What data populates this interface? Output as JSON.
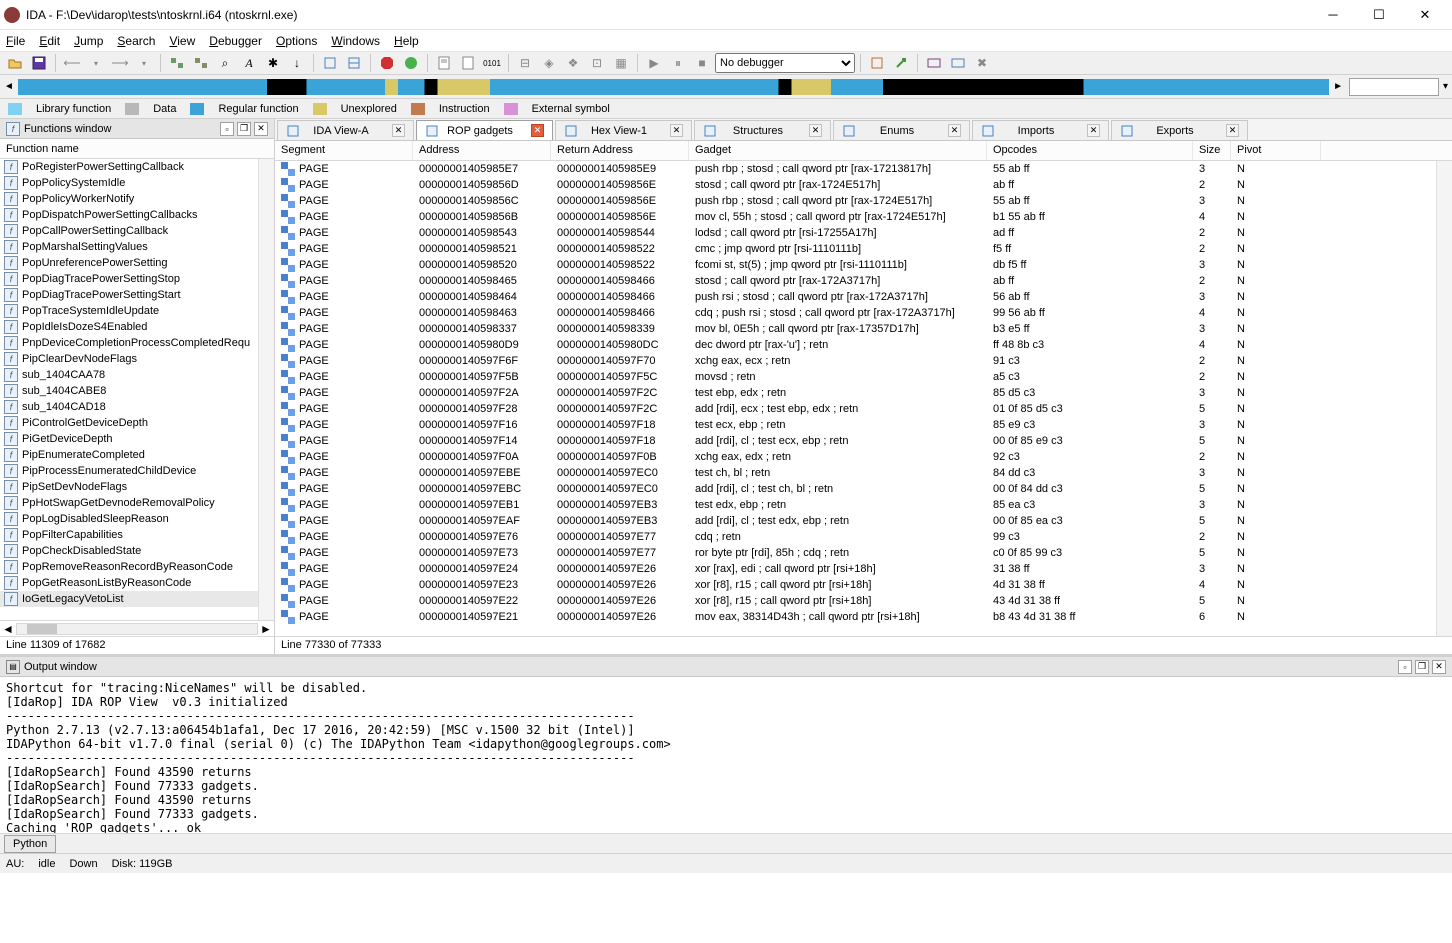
{
  "window": {
    "title": "IDA - F:\\Dev\\idarop\\tests\\ntoskrnl.i64 (ntoskrnl.exe)"
  },
  "menus": [
    "File",
    "Edit",
    "Jump",
    "Search",
    "View",
    "Debugger",
    "Options",
    "Windows",
    "Help"
  ],
  "debugger_select": "No debugger",
  "legend": [
    {
      "c": "#7fd3f0",
      "t": "Library function"
    },
    {
      "c": "#b8b8b8",
      "t": "Data"
    },
    {
      "c": "#3aa4d9",
      "t": "Regular function"
    },
    {
      "c": "#d8c867",
      "t": "Unexplored"
    },
    {
      "c": "#c47a4f",
      "t": "Instruction"
    },
    {
      "c": "#d892d8",
      "t": "External symbol"
    }
  ],
  "functions_title": "Functions window",
  "functions_col": "Function name",
  "functions": [
    "PoRegisterPowerSettingCallback",
    "PopPolicySystemIdle",
    "PopPolicyWorkerNotify",
    "PopDispatchPowerSettingCallbacks",
    "PopCallPowerSettingCallback",
    "PopMarshalSettingValues",
    "PopUnreferencePowerSetting",
    "PopDiagTracePowerSettingStop",
    "PopDiagTracePowerSettingStart",
    "PopTraceSystemIdleUpdate",
    "PopIdleIsDozeS4Enabled",
    "PnpDeviceCompletionProcessCompletedRequ",
    "PipClearDevNodeFlags",
    "sub_1404CAA78",
    "sub_1404CABE8",
    "sub_1404CAD18",
    "PiControlGetDeviceDepth",
    "PiGetDeviceDepth",
    "PipEnumerateCompleted",
    "PipProcessEnumeratedChildDevice",
    "PipSetDevNodeFlags",
    "PpHotSwapGetDevnodeRemovalPolicy",
    "PopLogDisabledSleepReason",
    "PopFilterCapabilities",
    "PopCheckDisabledState",
    "PopRemoveReasonRecordByReasonCode",
    "PopGetReasonListByReasonCode",
    "IoGetLegacyVetoList"
  ],
  "functions_sel": 27,
  "functions_status": "Line 11309 of 17682",
  "tabs": [
    {
      "l": "IDA View-A",
      "a": false,
      "icon": "ida"
    },
    {
      "l": "ROP gadgets",
      "a": true,
      "icon": "rop"
    },
    {
      "l": "Hex View-1",
      "a": false,
      "icon": "hex"
    },
    {
      "l": "Structures",
      "a": false,
      "icon": "struct"
    },
    {
      "l": "Enums",
      "a": false,
      "icon": "enum"
    },
    {
      "l": "Imports",
      "a": false,
      "icon": "imp"
    },
    {
      "l": "Exports",
      "a": false,
      "icon": "exp"
    }
  ],
  "grid_cols": [
    "Segment",
    "Address",
    "Return Address",
    "Gadget",
    "Opcodes",
    "Size",
    "Pivot"
  ],
  "rows": [
    [
      "PAGE",
      "00000001405985E7",
      "00000001405985E9",
      "push rbp ; stosd ; call qword ptr [rax-17213817h]",
      "55 ab ff",
      "3",
      "N"
    ],
    [
      "PAGE",
      "000000014059856D",
      "000000014059856E",
      "stosd ; call qword ptr [rax-1724E517h]",
      "ab ff",
      "2",
      "N"
    ],
    [
      "PAGE",
      "000000014059856C",
      "000000014059856E",
      "push rbp ; stosd ; call qword ptr [rax-1724E517h]",
      "55 ab ff",
      "3",
      "N"
    ],
    [
      "PAGE",
      "000000014059856B",
      "000000014059856E",
      "mov cl, 55h ; stosd ; call qword ptr [rax-1724E517h]",
      "b1 55 ab ff",
      "4",
      "N"
    ],
    [
      "PAGE",
      "0000000140598543",
      "0000000140598544",
      "lodsd ; call qword ptr [rsi-17255A17h]",
      "ad ff",
      "2",
      "N"
    ],
    [
      "PAGE",
      "0000000140598521",
      "0000000140598522",
      "cmc ; jmp qword ptr [rsi-1110111b]",
      "f5 ff",
      "2",
      "N"
    ],
    [
      "PAGE",
      "0000000140598520",
      "0000000140598522",
      "fcomi st, st(5) ; jmp qword ptr [rsi-1110111b]",
      "db f5 ff",
      "3",
      "N"
    ],
    [
      "PAGE",
      "0000000140598465",
      "0000000140598466",
      "stosd ; call qword ptr [rax-172A3717h]",
      "ab ff",
      "2",
      "N"
    ],
    [
      "PAGE",
      "0000000140598464",
      "0000000140598466",
      "push rsi ; stosd ; call qword ptr [rax-172A3717h]",
      "56 ab ff",
      "3",
      "N"
    ],
    [
      "PAGE",
      "0000000140598463",
      "0000000140598466",
      "cdq ; push rsi ; stosd ; call qword ptr [rax-172A3717h]",
      "99 56 ab ff",
      "4",
      "N"
    ],
    [
      "PAGE",
      "0000000140598337",
      "0000000140598339",
      "mov bl, 0E5h ; call qword ptr [rax-17357D17h]",
      "b3 e5 ff",
      "3",
      "N"
    ],
    [
      "PAGE",
      "00000001405980D9",
      "00000001405980DC",
      "dec dword ptr [rax-'u'] ; retn",
      "ff 48 8b c3",
      "4",
      "N"
    ],
    [
      "PAGE",
      "0000000140597F6F",
      "0000000140597F70",
      "xchg eax, ecx ; retn",
      "91 c3",
      "2",
      "N"
    ],
    [
      "PAGE",
      "0000000140597F5B",
      "0000000140597F5C",
      "movsd ; retn",
      "a5 c3",
      "2",
      "N"
    ],
    [
      "PAGE",
      "0000000140597F2A",
      "0000000140597F2C",
      "test ebp, edx ; retn",
      "85 d5 c3",
      "3",
      "N"
    ],
    [
      "PAGE",
      "0000000140597F28",
      "0000000140597F2C",
      "add [rdi], ecx ; test ebp, edx ; retn",
      "01 0f 85 d5 c3",
      "5",
      "N"
    ],
    [
      "PAGE",
      "0000000140597F16",
      "0000000140597F18",
      "test ecx, ebp ; retn",
      "85 e9 c3",
      "3",
      "N"
    ],
    [
      "PAGE",
      "0000000140597F14",
      "0000000140597F18",
      "add [rdi], cl ; test ecx, ebp ; retn",
      "00 0f 85 e9 c3",
      "5",
      "N"
    ],
    [
      "PAGE",
      "0000000140597F0A",
      "0000000140597F0B",
      "xchg eax, edx ; retn",
      "92 c3",
      "2",
      "N"
    ],
    [
      "PAGE",
      "0000000140597EBE",
      "0000000140597EC0",
      "test ch, bl ; retn",
      "84 dd c3",
      "3",
      "N"
    ],
    [
      "PAGE",
      "0000000140597EBC",
      "0000000140597EC0",
      "add [rdi], cl ; test ch, bl ; retn",
      "00 0f 84 dd c3",
      "5",
      "N"
    ],
    [
      "PAGE",
      "0000000140597EB1",
      "0000000140597EB3",
      "test edx, ebp ; retn",
      "85 ea c3",
      "3",
      "N"
    ],
    [
      "PAGE",
      "0000000140597EAF",
      "0000000140597EB3",
      "add [rdi], cl ; test edx, ebp ; retn",
      "00 0f 85 ea c3",
      "5",
      "N"
    ],
    [
      "PAGE",
      "0000000140597E76",
      "0000000140597E77",
      "cdq ; retn",
      "99 c3",
      "2",
      "N"
    ],
    [
      "PAGE",
      "0000000140597E73",
      "0000000140597E77",
      "ror byte ptr [rdi], 85h ; cdq ; retn",
      "c0 0f 85 99 c3",
      "5",
      "N"
    ],
    [
      "PAGE",
      "0000000140597E24",
      "0000000140597E26",
      "xor [rax], edi ; call qword ptr [rsi+18h]",
      "31 38 ff",
      "3",
      "N"
    ],
    [
      "PAGE",
      "0000000140597E23",
      "0000000140597E26",
      "xor [r8], r15 ; call qword ptr [rsi+18h]",
      "4d 31 38 ff",
      "4",
      "N"
    ],
    [
      "PAGE",
      "0000000140597E22",
      "0000000140597E26",
      "xor [r8], r15 ; call qword ptr [rsi+18h]",
      "43 4d 31 38 ff",
      "5",
      "N"
    ],
    [
      "PAGE",
      "0000000140597E21",
      "0000000140597E26",
      "mov eax, 38314D43h ; call qword ptr [rsi+18h]",
      "b8 43 4d 31 38 ff",
      "6",
      "N"
    ]
  ],
  "grid_status": "Line 77330 of 77333",
  "output_title": "Output window",
  "output_text": "Shortcut for \"tracing:NiceNames\" will be disabled.\n[IdaRop] IDA ROP View  v0.3 initialized\n---------------------------------------------------------------------------------------\nPython 2.7.13 (v2.7.13:a06454b1afa1, Dec 17 2016, 20:42:59) [MSC v.1500 32 bit (Intel)]\nIDAPython 64-bit v1.7.0 final (serial 0) (c) The IDAPython Team <idapython@googlegroups.com>\n---------------------------------------------------------------------------------------\n[IdaRopSearch] Found 43590 returns\n[IdaRopSearch] Found 77333 gadgets.\n[IdaRopSearch] Found 43590 returns\n[IdaRopSearch] Found 77333 gadgets.\nCaching 'ROP gadgets'... ok",
  "output_tab": "Python",
  "status": {
    "au": "AU:",
    "idle": "idle",
    "down": "Down",
    "disk": "Disk: 119GB"
  }
}
